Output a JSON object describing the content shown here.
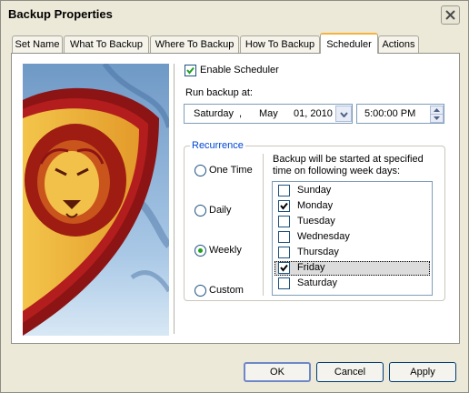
{
  "window": {
    "title": "Backup Properties"
  },
  "tabs": [
    {
      "label": "Set Name"
    },
    {
      "label": "What To Backup"
    },
    {
      "label": "Where To Backup"
    },
    {
      "label": "How To Backup"
    },
    {
      "label": "Scheduler",
      "active": true
    },
    {
      "label": "Actions"
    }
  ],
  "scheduler": {
    "enable_label": "Enable Scheduler",
    "enabled": true,
    "run_label": "Run backup at:",
    "date": {
      "weekday": "Saturday",
      "sep": ",",
      "month": "May",
      "day_year": "01, 2010"
    },
    "time": "5:00:00 PM",
    "recurrence": {
      "title": "Recurrence",
      "options": [
        {
          "label": "One Time",
          "selected": false
        },
        {
          "label": "Daily",
          "selected": false
        },
        {
          "label": "Weekly",
          "selected": true
        },
        {
          "label": "Custom",
          "selected": false
        }
      ],
      "weekday_caption": "Backup will be started at specified time on following week days:",
      "days": [
        {
          "label": "Sunday",
          "checked": false
        },
        {
          "label": "Monday",
          "checked": true
        },
        {
          "label": "Tuesday",
          "checked": false
        },
        {
          "label": "Wednesday",
          "checked": false
        },
        {
          "label": "Thursday",
          "checked": false
        },
        {
          "label": "Friday",
          "checked": true,
          "focused": true
        },
        {
          "label": "Saturday",
          "checked": false
        }
      ]
    }
  },
  "buttons": {
    "ok": "OK",
    "cancel": "Cancel",
    "apply": "Apply"
  },
  "colors": {
    "accent_tab": "#f7b23b",
    "check": "#21a121",
    "recurrence_title": "#0046d5"
  }
}
